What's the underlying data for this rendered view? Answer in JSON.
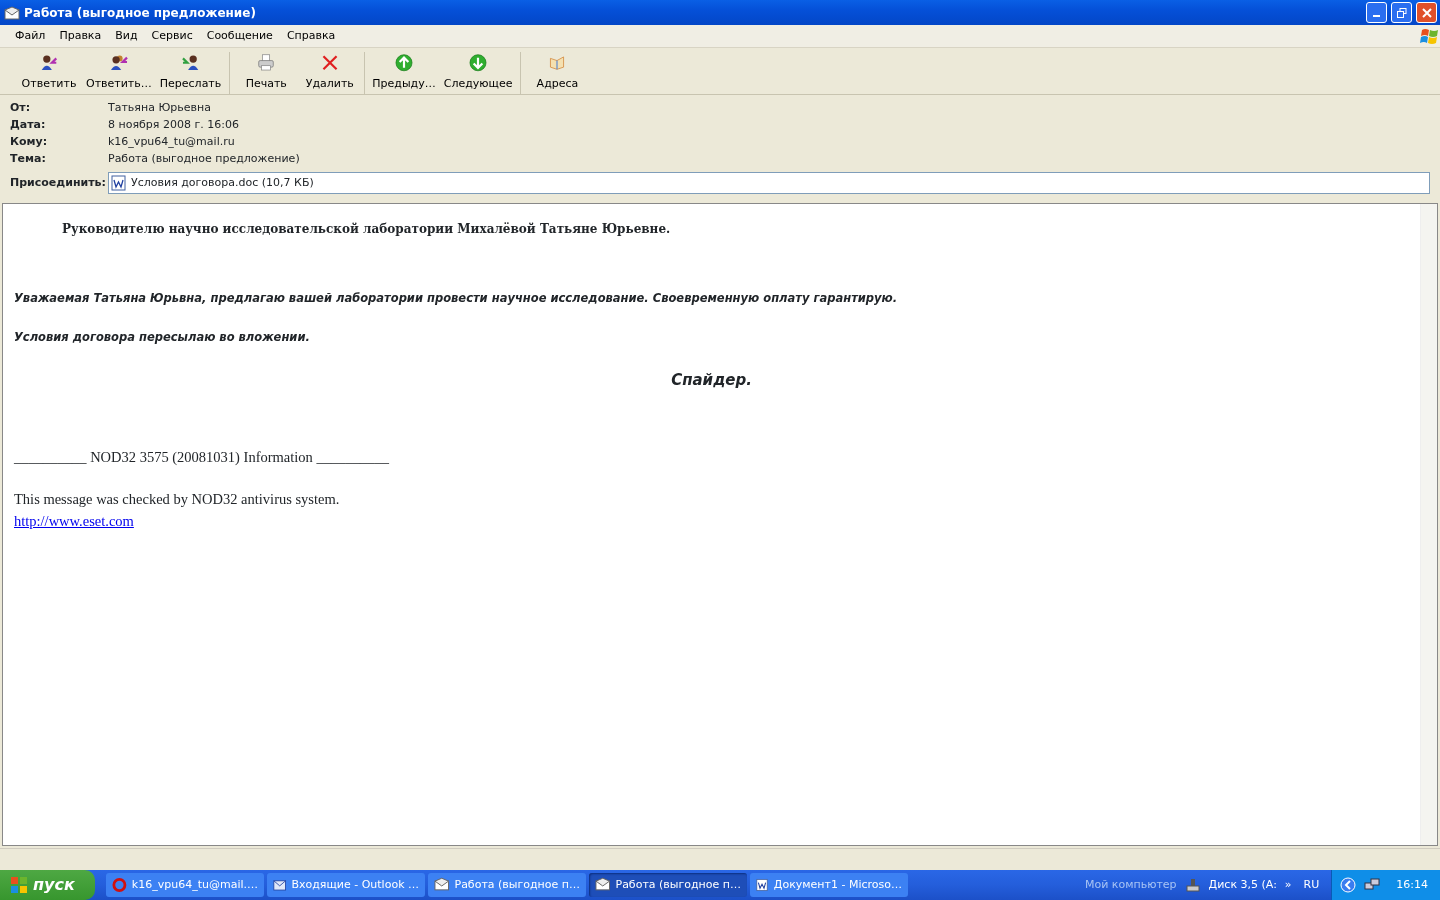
{
  "window": {
    "title": "Работа (выгодное предложение)"
  },
  "menu": [
    "Файл",
    "Правка",
    "Вид",
    "Сервис",
    "Сообщение",
    "Справка"
  ],
  "toolbar": [
    {
      "label": "Ответить",
      "kind": "reply",
      "group_end": false
    },
    {
      "label": "Ответить…",
      "kind": "reply-all",
      "group_end": false
    },
    {
      "label": "Переслать",
      "kind": "forward",
      "group_end": true
    },
    {
      "label": "Печать",
      "kind": "print",
      "group_end": false
    },
    {
      "label": "Удалить",
      "kind": "delete",
      "group_end": true
    },
    {
      "label": "Предыду…",
      "kind": "up",
      "group_end": false
    },
    {
      "label": "Следующее",
      "kind": "down",
      "group_end": true
    },
    {
      "label": "Адреса",
      "kind": "book",
      "group_end": false
    }
  ],
  "header": [
    {
      "label": "От:",
      "value": "Татьяна Юрьевна"
    },
    {
      "label": "Дата:",
      "value": "8 ноября 2008 г. 16:06"
    },
    {
      "label": "Кому:",
      "value": "k16_vpu64_tu@mail.ru"
    },
    {
      "label": "Тема:",
      "value": "Работа (выгодное предложение)"
    }
  ],
  "attachment": {
    "label": "Присоединить:",
    "file": "Условия договора.doc (10,7 КБ)"
  },
  "body": [
    {
      "kind": "address",
      "text": "Руководителю  научно исследовательской лаборатории Михалёвой Татьяне Юрьевне."
    },
    {
      "kind": "italic",
      "text": "Уважаемая Татьяна Юрьвна, предлагаю вашей лаборатории  провести научное  исследование. Своевременную оплату гарантирую."
    },
    {
      "kind": "italic",
      "text": "Условия договора пересылаю во вложении."
    },
    {
      "kind": "signature",
      "text": "Спайдер."
    },
    {
      "kind": "footer",
      "text": "__________ NOD32 3575 (20081031) Information __________"
    },
    {
      "kind": "footer-gap",
      "text": "This message was checked by NOD32 antivirus system."
    },
    {
      "kind": "link",
      "text": "http://www.eset.com"
    }
  ],
  "taskbar": {
    "start": "пуск",
    "tasks": [
      {
        "label": "k16_vpu64_tu@mail.…",
        "kind": "opera",
        "selected": false
      },
      {
        "label": "Входящие - Outlook …",
        "kind": "outlook",
        "selected": false
      },
      {
        "label": "Работа (выгодное п…",
        "kind": "mail",
        "selected": false
      },
      {
        "label": "Работа (выгодное п…",
        "kind": "mail",
        "selected": true
      },
      {
        "label": "Документ1 - Microso…",
        "kind": "word",
        "selected": false
      }
    ],
    "toolbar_label": "Мой компьютер",
    "drive": "Диск 3,5 (A:",
    "chevron": "»",
    "language": "RU",
    "clock": "16:14"
  }
}
